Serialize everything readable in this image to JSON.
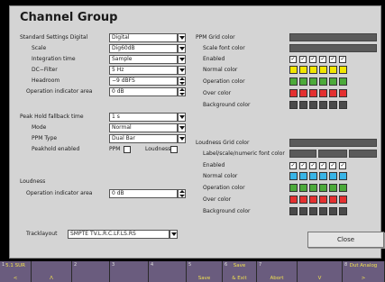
{
  "title": "Channel Group",
  "left": {
    "standard_settings": {
      "label": "Standard Settings Digital",
      "value": "Digital"
    },
    "scale": {
      "label": "Scale",
      "value": "Dig60dB"
    },
    "integration_time": {
      "label": "Integration time",
      "value": "Sample"
    },
    "dc_filter": {
      "label": "DC−Filter",
      "value": "5 Hz"
    },
    "headroom": {
      "label": "Headroom",
      "value": "−9 dBFS"
    },
    "operation_indicator_area": {
      "label": "Operation indicator area",
      "value": "0 dB"
    },
    "peak_hold": {
      "label": "Peak Hold fallback time",
      "value": "1 s"
    },
    "mode": {
      "label": "Mode",
      "value": "Normal"
    },
    "ppm_type": {
      "label": "PPM Type",
      "value": "Dual Bar"
    },
    "peakhold_enabled": {
      "label": "Peakhold enabled",
      "ppm_label": "PPM",
      "loudness_label": "Loudness"
    },
    "loudness": {
      "label": "Loudness"
    },
    "loud_op_area": {
      "label": "Operation indicator area",
      "value": "0 dB"
    },
    "tracklayout": {
      "label": "Tracklayout",
      "value": "SMPTE TV.L.R.C.LF.LS.RS"
    }
  },
  "right": {
    "ppm_grid_color": "PPM Grid color",
    "scale_font_color": "Scale font color",
    "enabled": "Enabled",
    "normal_color": "Normal color",
    "operation_color": "Operation color",
    "over_color": "Over color",
    "background_color": "Background color",
    "loudness_grid_color": "Loudness Grid color",
    "label_font_color": "Label/scale/numeric font color",
    "l_enabled": "Enabled",
    "l_normal_color": "Normal color",
    "l_operation_color": "Operation color",
    "l_over_color": "Over color",
    "l_background_color": "Background color"
  },
  "check_glyph": "✓",
  "colors": {
    "normal_ppm": "#f2e600",
    "normal_loud": "#38b4e6",
    "operation": "#4caa3a",
    "over": "#e43030",
    "background": "#4a4a4a"
  },
  "close_label": "Close",
  "softkeys": [
    {
      "num": "1",
      "top": "5.1 SUR",
      "bottom": "<"
    },
    {
      "num": "",
      "top": "",
      "bottom": "Λ"
    },
    {
      "num": "2",
      "top": "",
      "bottom": ""
    },
    {
      "num": "3",
      "top": "",
      "bottom": ""
    },
    {
      "num": "4",
      "top": "",
      "bottom": ""
    },
    {
      "num": "5",
      "top": "",
      "bottom": "Save"
    },
    {
      "num": "6",
      "top": "Save",
      "bottom": "& Exit"
    },
    {
      "num": "7",
      "top": "",
      "bottom": "Abort"
    },
    {
      "num": "",
      "top": "",
      "bottom": "V"
    },
    {
      "num": "8",
      "top": "Dut Analog",
      "bottom": ">"
    }
  ]
}
